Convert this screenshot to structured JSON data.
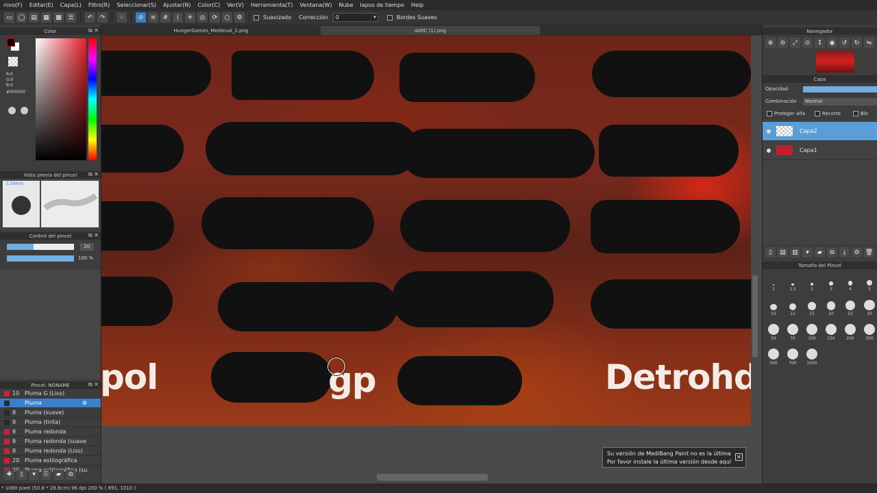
{
  "menu": [
    "nivo(F)",
    "Editar(E)",
    "Capa(L)",
    "Filtro(R)",
    "Seleccionar(S)",
    "Ajustar(N)",
    "Color(C)",
    "Ver(V)",
    "Herramienta(T)",
    "Ventana(W)",
    "Nube",
    "lapso de tiempo",
    "Help"
  ],
  "toolbar": {
    "smooth_label": "Suavizado",
    "correction_label": "Corrección",
    "correction_value": "0",
    "soft_edges_label": "Bordes Suaves"
  },
  "tabs": [
    "HungerGames_Medieval_2.png",
    "dARC (1).png"
  ],
  "color_panel": {
    "title": "Color",
    "r": "R:0",
    "g": "G:0",
    "b": "B:0",
    "hex": "#000000",
    "fg_color": "#000000",
    "bg_color": "#ffffff"
  },
  "brush_preview": {
    "title": "Vista previa del pincel",
    "size_label": "5.29mm"
  },
  "brush_control": {
    "title": "Control del pincel",
    "size_value": "20",
    "opacity_value": "100 %",
    "size_fraction": 0.4,
    "opacity_fraction": 1.0
  },
  "brush_list": {
    "title": "Pincel: NONAME",
    "items": [
      {
        "size": "10",
        "name": "Pluma G (Liso)",
        "color": "#cc2233"
      },
      {
        "size": "",
        "name": "Pluma",
        "color": "#2a2a2a",
        "selected": true
      },
      {
        "size": "8",
        "name": "Pluma (suave)",
        "color": "#2a2a2a"
      },
      {
        "size": "8",
        "name": "Pluma (tinta)",
        "color": "#2a2a2a"
      },
      {
        "size": "8",
        "name": "Pluma redonda",
        "color": "#cc2233"
      },
      {
        "size": "8",
        "name": "Pluma redonda (suave",
        "color": "#cc2233"
      },
      {
        "size": "8",
        "name": "Pluma redonda (Liso)",
        "color": "#cc2233"
      },
      {
        "size": "20",
        "name": "Pluma estilográfica",
        "color": "#cc2233"
      },
      {
        "size": "20",
        "name": "Pluma estilográfica (su",
        "color": "#cc2233"
      }
    ]
  },
  "canvas": {
    "words": [
      "pol",
      "gp",
      "Detrohd"
    ]
  },
  "navigator": {
    "title": "Navegador"
  },
  "layers": {
    "title": "Capa",
    "opacity_label": "Opacidad",
    "blend_label": "Combinación",
    "blend_value": "Normal",
    "protect_alpha": "Proteger alfa",
    "clip": "Recorte",
    "lock": "Blo",
    "items": [
      {
        "name": "Capa2",
        "selected": true
      },
      {
        "name": "Capa1",
        "selected": false
      }
    ]
  },
  "brush_size": {
    "title": "Tamaño del Pincel",
    "sizes": [
      "1",
      "1.5",
      "2",
      "3",
      "4",
      "5",
      "10",
      "12",
      "15",
      "20",
      "25",
      "30",
      "50",
      "70",
      "100",
      "150",
      "200",
      "300",
      "500",
      "700",
      "1000"
    ]
  },
  "notification": {
    "line1": "Su versión de MediBang Paint no es la última",
    "line2": "Por favor instale la última versión desde aquí"
  },
  "status": "* 1080 pixel  (50.8 * 28.6cm)  96 dpi  200 %  ( 891, 1010 )"
}
